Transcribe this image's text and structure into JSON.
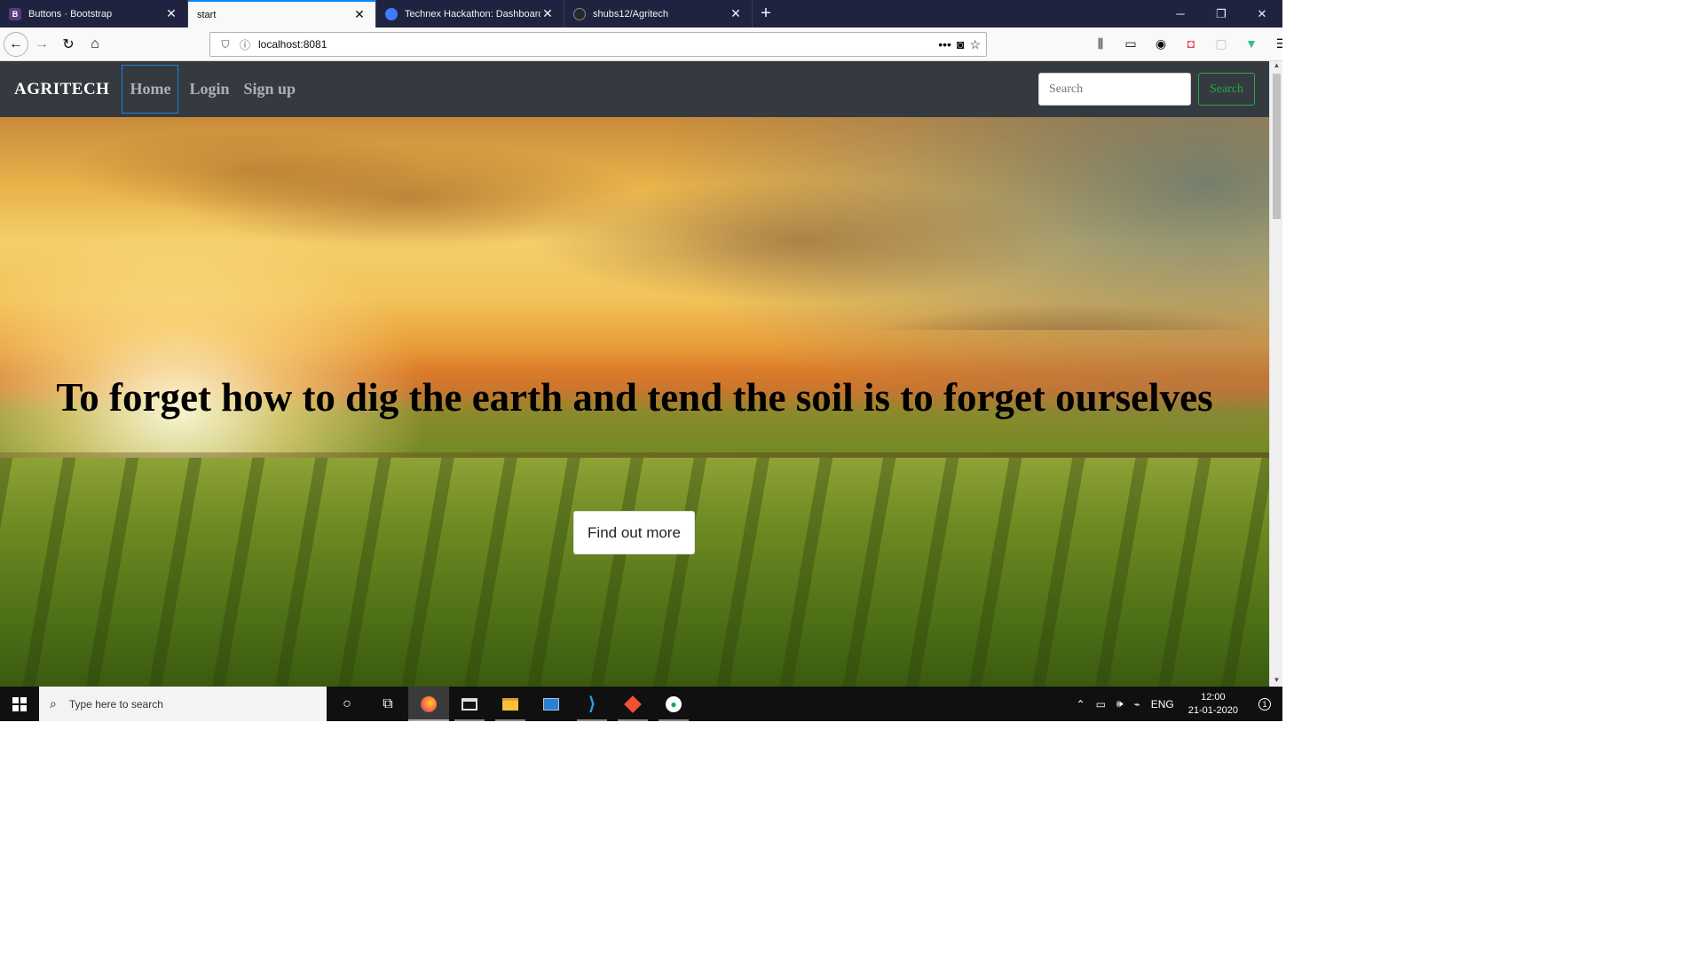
{
  "browser": {
    "tabs": [
      {
        "title": "Buttons · Bootstrap",
        "favicon_letter": "B",
        "favicon_color": "#563d7c",
        "active": false
      },
      {
        "title": "start",
        "favicon_letter": "",
        "favicon_color": "",
        "active": true
      },
      {
        "title": "Technex Hackathon: Dashboard",
        "favicon_letter": "",
        "favicon_color": "#3f7bff",
        "active": false
      },
      {
        "title": "shubs12/Agritech",
        "favicon_letter": "",
        "favicon_color": "#24292e",
        "active": false
      }
    ],
    "new_tab_label": "+",
    "url": "localhost:8081"
  },
  "site": {
    "brand": "AGRITECH",
    "nav_links": [
      "Home",
      "Login",
      "Sign up"
    ],
    "search_placeholder": "Search",
    "search_button": "Search",
    "hero_title": "To forget how to dig the earth and tend the soil is to forget ourselves",
    "cta_button": "Find out more"
  },
  "taskbar": {
    "search_placeholder": "Type here to search",
    "language": "ENG",
    "time": "12:00",
    "date": "21-01-2020",
    "notification_count": "1"
  },
  "colors": {
    "site_nav_bg": "#343a40",
    "search_btn_accent": "#28a745",
    "active_tab_accent": "#0a84ff",
    "taskbar_bg": "#101010"
  }
}
